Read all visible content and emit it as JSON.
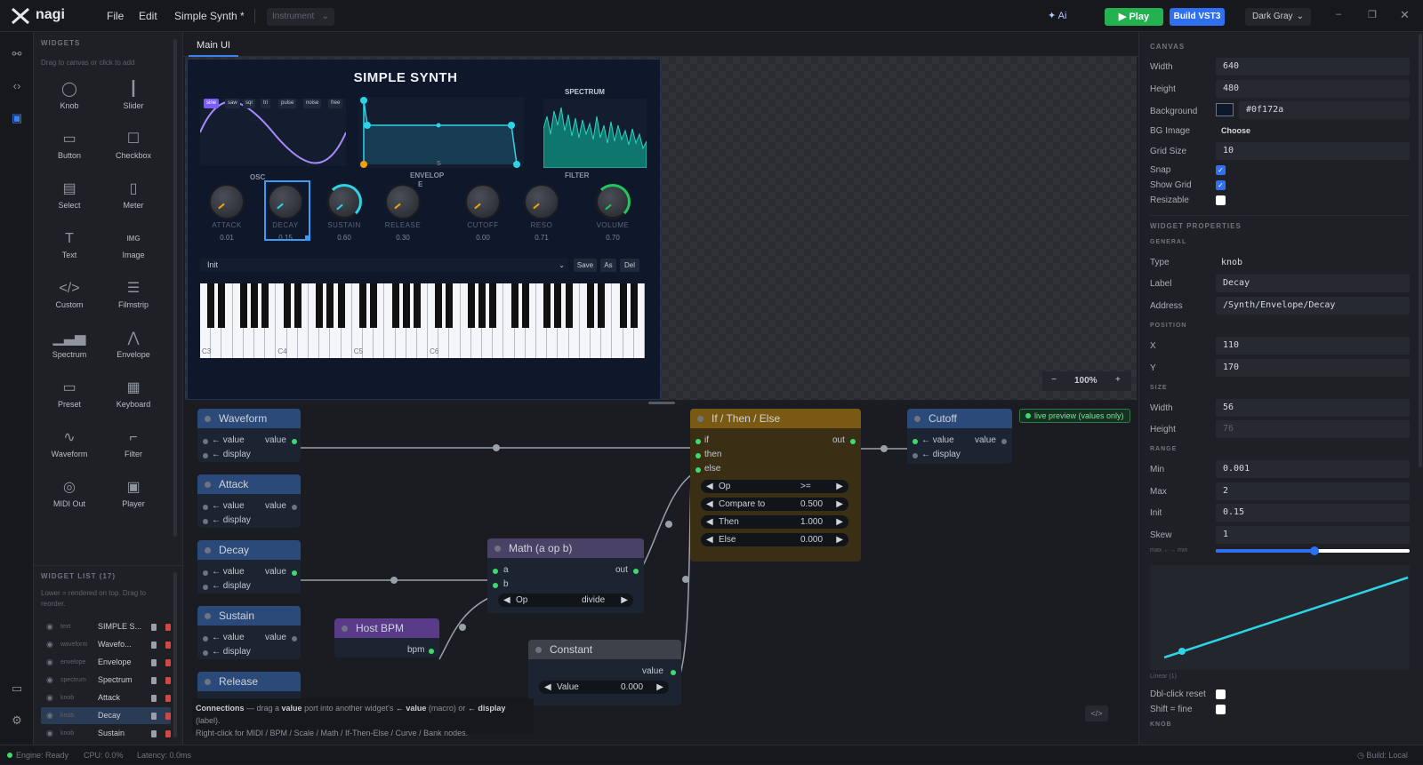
{
  "app": {
    "name": "nagi",
    "menus": [
      "File",
      "Edit"
    ],
    "project": "Simple Synth *",
    "mode": "Instrument",
    "ai": "Ai",
    "play": "Play",
    "build": "Build VST3",
    "theme": "Dark Gray"
  },
  "widgets": {
    "title": "WIDGETS",
    "hint": "Drag to canvas or click to add",
    "items": [
      {
        "label": "Knob",
        "icon": "knob-icon"
      },
      {
        "label": "Slider",
        "icon": "slider-icon"
      },
      {
        "label": "Button",
        "icon": "button-icon"
      },
      {
        "label": "Checkbox",
        "icon": "checkbox-icon"
      },
      {
        "label": "Select",
        "icon": "select-icon"
      },
      {
        "label": "Meter",
        "icon": "meter-icon"
      },
      {
        "label": "Text",
        "icon": "text-icon"
      },
      {
        "label": "Image",
        "icon": "image-icon"
      },
      {
        "label": "Custom",
        "icon": "custom-icon"
      },
      {
        "label": "Filmstrip",
        "icon": "filmstrip-icon"
      },
      {
        "label": "Spectrum",
        "icon": "spectrum-icon"
      },
      {
        "label": "Envelope",
        "icon": "envelope-icon"
      },
      {
        "label": "Preset",
        "icon": "preset-icon"
      },
      {
        "label": "Keyboard",
        "icon": "keyboard-icon"
      },
      {
        "label": "Waveform",
        "icon": "waveform-icon"
      },
      {
        "label": "Filter",
        "icon": "filter-icon"
      },
      {
        "label": "MIDI Out",
        "icon": "midi-icon"
      },
      {
        "label": "Player",
        "icon": "player-icon"
      }
    ],
    "image_glyph": "IMG",
    "list_title": "WIDGET LIST (17)",
    "list_hint": "Lower = rendered on top. Drag to reorder.",
    "list": [
      {
        "type": "text",
        "name": "SIMPLE S..."
      },
      {
        "type": "waveform",
        "name": "Wavefo..."
      },
      {
        "type": "envelope",
        "name": "Envelope"
      },
      {
        "type": "spectrum",
        "name": "Spectrum"
      },
      {
        "type": "knob",
        "name": "Attack"
      },
      {
        "type": "knob",
        "name": "Decay"
      },
      {
        "type": "knob",
        "name": "Sustain"
      },
      {
        "type": "knob",
        "name": "Release"
      }
    ]
  },
  "tab": "Main UI",
  "synth": {
    "title": "SIMPLE SYNTH",
    "wave_buttons": [
      "sine",
      "saw",
      "sqr",
      "tri",
      "pulse",
      "noise",
      "free"
    ],
    "sections": {
      "osc": "OSC",
      "envelope": "ENVELOP",
      "envelope_e": "E",
      "filter": "FILTER",
      "spectrum": "SPECTRUM",
      "s_marker": "S"
    },
    "knobs": [
      {
        "label": "ATTACK",
        "value": "0.01"
      },
      {
        "label": "DECAY",
        "value": "0.15"
      },
      {
        "label": "SUSTAIN",
        "value": "0.60"
      },
      {
        "label": "RELEASE",
        "value": "0.30"
      },
      {
        "label": "CUTOFF",
        "value": "0.00"
      },
      {
        "label": "RESO",
        "value": "0.71"
      },
      {
        "label": "VOLUME",
        "value": "0.70"
      }
    ],
    "preset": {
      "value": "Init",
      "save": "Save",
      "as": "As",
      "del": "Del"
    },
    "octaves": [
      "C3",
      "C4",
      "C5",
      "C6"
    ]
  },
  "zoom": {
    "minus": "−",
    "value": "100%",
    "plus": "+"
  },
  "graph": {
    "live_preview": "live preview (values only)",
    "port_value_in": "← value",
    "port_display_in": "← display",
    "port_value_out": "value",
    "nodes": {
      "waveform": "Waveform",
      "attack": "Attack",
      "decay": "Decay",
      "sustain": "Sustain",
      "release": "Release",
      "host_bpm": "Host BPM",
      "bpm": "bpm",
      "math": "Math (a op b)",
      "a": "a",
      "b": "b",
      "out": "out",
      "op": "Op",
      "math_op": "divide",
      "constant": "Constant",
      "const_value_label": "Value",
      "const_value": "0.000",
      "ifthen": "If / Then / Else",
      "if": "if",
      "then": "then",
      "else": "else",
      "if_op": ">=",
      "compare_to": "Compare to",
      "compare_val": "0.500",
      "then_label": "Then",
      "then_val": "1.000",
      "else_label": "Else",
      "else_val": "0.000",
      "cutoff": "Cutoff"
    },
    "help_1a": "Connections",
    "help_1b": " — drag a ",
    "help_1c": "value",
    "help_1d": " port into another widget's ",
    "help_1e": "← value",
    "help_1f": " (macro) or ",
    "help_1g": "← display",
    "help_1h": " (label).",
    "help_2": "Right-click for MIDI / BPM / Scale / Math / If-Then-Else / Curve / Bank nodes.",
    "code_toggle": "</>"
  },
  "props": {
    "canvas_title": "CANVAS",
    "width_label": "Width",
    "width": "640",
    "height_label": "Height",
    "height": "480",
    "bg_label": "Background",
    "bg": "#0f172a",
    "bgimg_label": "BG Image",
    "bgimg": "Choose",
    "grid_label": "Grid Size",
    "grid": "10",
    "snap_label": "Snap",
    "showgrid_label": "Show Grid",
    "resizable_label": "Resizable",
    "snap": true,
    "show_grid": true,
    "resizable": false,
    "wp_title": "WIDGET PROPERTIES",
    "general": "GENERAL",
    "type_label": "Type",
    "type": "knob",
    "label_label": "Label",
    "label": "Decay",
    "address_label": "Address",
    "address": "/Synth/Envelope/Decay",
    "position": "POSITION",
    "x_label": "X",
    "x": "110",
    "y_label": "Y",
    "y": "170",
    "size": "SIZE",
    "w_label": "Width",
    "w": "56",
    "h_label": "Height",
    "h": "76",
    "range": "RANGE",
    "min_label": "Min",
    "min": "0.001",
    "max_label": "Max",
    "max": "2",
    "init_label": "Init",
    "init": "0.15",
    "skew_label": "Skew",
    "skew": "1",
    "skew_slider_label": "max ←→ min",
    "skew_level": 0.51,
    "curve_label": "Linear (1)",
    "dbl_label": "Dbl-click reset",
    "shift_label": "Shift = fine",
    "dbl_reset": false,
    "shift_fine": false,
    "knob_title": "KNOB"
  },
  "status": {
    "engine": "Engine: Ready",
    "cpu": "CPU: 0.0%",
    "latency": "Latency: 0.0ms",
    "build": "Build: Local"
  },
  "colors": {
    "accent": "#2f6ff0",
    "play": "#23b24f",
    "wire": "#9aa0aa",
    "port": "#3ddc6c",
    "synth_bg": "#0f172a",
    "cyan": "#2dd4e8"
  }
}
